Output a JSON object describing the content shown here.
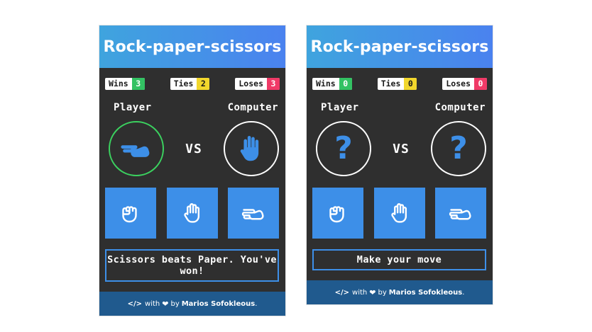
{
  "cards": [
    {
      "title": "Rock-paper-scissors",
      "scores": {
        "wins_label": "Wins",
        "wins": "3",
        "ties_label": "Ties",
        "ties": "2",
        "loses_label": "Loses",
        "loses": "3"
      },
      "player_label": "Player",
      "computer_label": "Computer",
      "vs": "VS",
      "player_choice": "scissors-hand-icon",
      "computer_choice": "paper-hand-icon",
      "player_result_color": "#3bd15f",
      "message": "Scissors beats Paper. You've won!",
      "footer": {
        "with": "with",
        "by": "by",
        "author": "Marios Sofokleous",
        "period": "."
      }
    },
    {
      "title": "Rock-paper-scissors",
      "scores": {
        "wins_label": "Wins",
        "wins": "0",
        "ties_label": "Ties",
        "ties": "0",
        "loses_label": "Loses",
        "loses": "0"
      },
      "player_label": "Player",
      "computer_label": "Computer",
      "vs": "VS",
      "unknown_symbol": "?",
      "message": "Make your move",
      "footer": {
        "with": "with",
        "by": "by",
        "author": "Marios Sofokleous",
        "period": "."
      }
    }
  ],
  "moves": [
    "rock-hand-icon",
    "paper-hand-icon",
    "scissors-hand-icon"
  ],
  "colors": {
    "accent": "#3d8fe8",
    "background": "#2f2f2f",
    "header_gradient": [
      "#3fa4de",
      "#4a82ef"
    ],
    "footer": "#205a8e",
    "win": "#33c263",
    "tie": "#f2d72c",
    "lose": "#f03a67"
  }
}
